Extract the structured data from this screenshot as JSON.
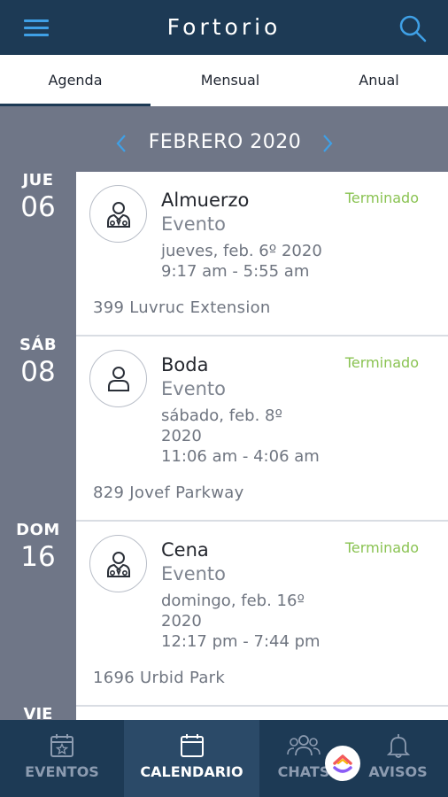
{
  "app": {
    "title": "Fortorio"
  },
  "tabs": [
    {
      "label": "Agenda",
      "active": true
    },
    {
      "label": "Mensual",
      "active": false
    },
    {
      "label": "Anual",
      "active": false
    }
  ],
  "calendar": {
    "month_title": "FEBRERO 2020"
  },
  "events": [
    {
      "weekday": "JUE",
      "day": "06",
      "title": "Almuerzo",
      "type": "Evento",
      "date_line1": "jueves, feb. 6º 2020",
      "date_line2": "",
      "time": "9:17 am - 5:55 am",
      "status": "Terminado",
      "address": "399 Luvruc Extension",
      "icon": "person-tie-icon"
    },
    {
      "weekday": "SÁB",
      "day": "08",
      "title": "Boda",
      "type": "Evento",
      "date_line1": "sábado, feb. 8º",
      "date_line2": "2020",
      "time": "11:06 am - 4:06 am",
      "status": "Terminado",
      "address": "829 Jovef Parkway",
      "icon": "person-icon"
    },
    {
      "weekday": "DOM",
      "day": "16",
      "title": "Cena",
      "type": "Evento",
      "date_line1": "domingo, feb. 16º",
      "date_line2": "2020",
      "time": "12:17 pm - 7:44 pm",
      "status": "Terminado",
      "address": "1696 Urbid Park",
      "icon": "person-tie-icon"
    }
  ],
  "next_day_partial": {
    "weekday": "VIE"
  },
  "bottom_nav": [
    {
      "label": "EVENTOS",
      "icon": "calendar-star-icon",
      "active": false
    },
    {
      "label": "CALENDARIO",
      "icon": "calendar-icon",
      "active": true
    },
    {
      "label": "CHATS",
      "icon": "group-icon",
      "active": false
    },
    {
      "label": "AVISOS",
      "icon": "bell-icon",
      "active": false
    }
  ],
  "colors": {
    "header": "#1d3a55",
    "accent": "#3fa0e6",
    "background": "#6f7687",
    "status_done": "#8ac352"
  }
}
